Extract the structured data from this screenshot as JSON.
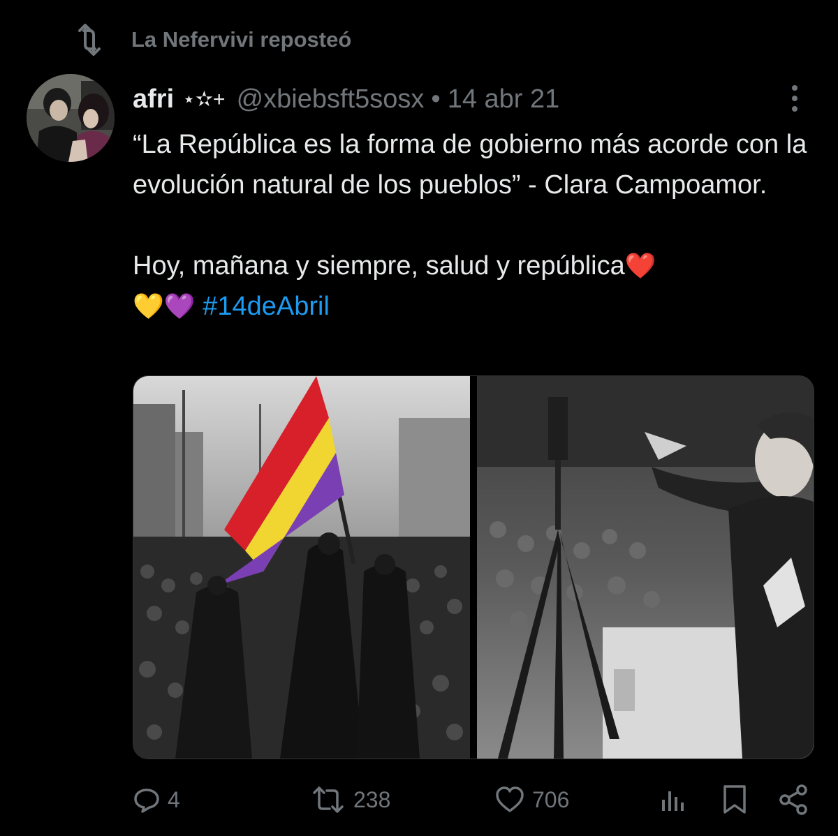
{
  "repost": {
    "label": "La Nefervivi reposteó",
    "icon": "repost-icon"
  },
  "author": {
    "name": "afri",
    "badge": "⋆✫+",
    "handle": "@xbiebsft5sosx",
    "separator": "•",
    "date": "14 abr 21",
    "avatar": "avatar-photo"
  },
  "tweet": {
    "line1": "“La República es la forma de gobierno más acorde con la evolución natural de los pueblos” - Clara Campoamor.",
    "line2": "Hoy, mañana y siempre, salud y república",
    "emojis_end": "❤️",
    "emojis_next": "💛💜",
    "hashtag": "#14deAbril"
  },
  "media": {
    "left_image": "black-white-crowd-with-colored-republican-flag",
    "right_image": "black-white-woman-speaking-at-microphone",
    "flag_colors": [
      "#d7202a",
      "#f1d531",
      "#7a3fb2"
    ]
  },
  "actions": {
    "reply_count": "4",
    "repost_count": "238",
    "like_count": "706",
    "colors": {
      "muted": "#71767b",
      "link": "#1d9bf0"
    }
  }
}
